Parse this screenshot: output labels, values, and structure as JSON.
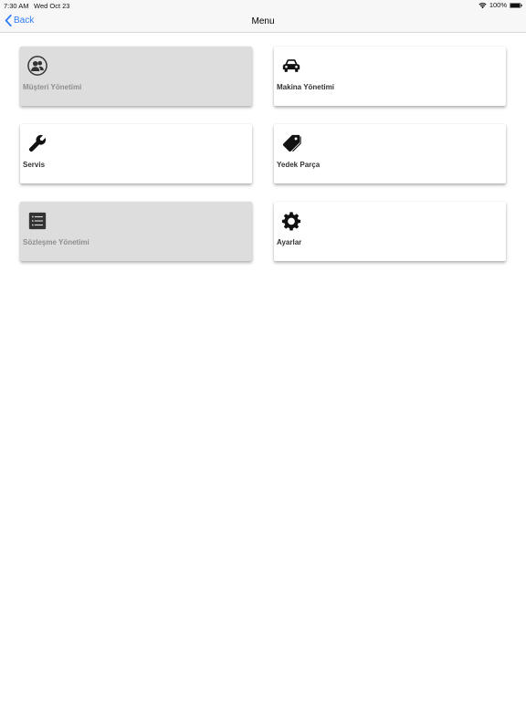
{
  "status_bar": {
    "time": "7:30 AM",
    "date": "Wed Oct 23",
    "battery": "100%"
  },
  "nav": {
    "back_label": "Back",
    "title": "Menu"
  },
  "menu": {
    "items": [
      {
        "label": "Müşteri Yönetimi",
        "icon": "users-icon",
        "style": "gray"
      },
      {
        "label": "Makina Yönetimi",
        "icon": "car-icon",
        "style": "white"
      },
      {
        "label": "Servis",
        "icon": "wrench-icon",
        "style": "white"
      },
      {
        "label": "Yedek Parça",
        "icon": "tag-icon",
        "style": "white"
      },
      {
        "label": "Sözleşme Yönetimi",
        "icon": "list-icon",
        "style": "gray"
      },
      {
        "label": "Ayarlar",
        "icon": "gear-icon",
        "style": "white"
      }
    ]
  },
  "colors": {
    "accent": "#2f7cf6",
    "card_gray": "#dddddd",
    "card_white": "#ffffff",
    "nav_background": "#f7f7f7"
  }
}
